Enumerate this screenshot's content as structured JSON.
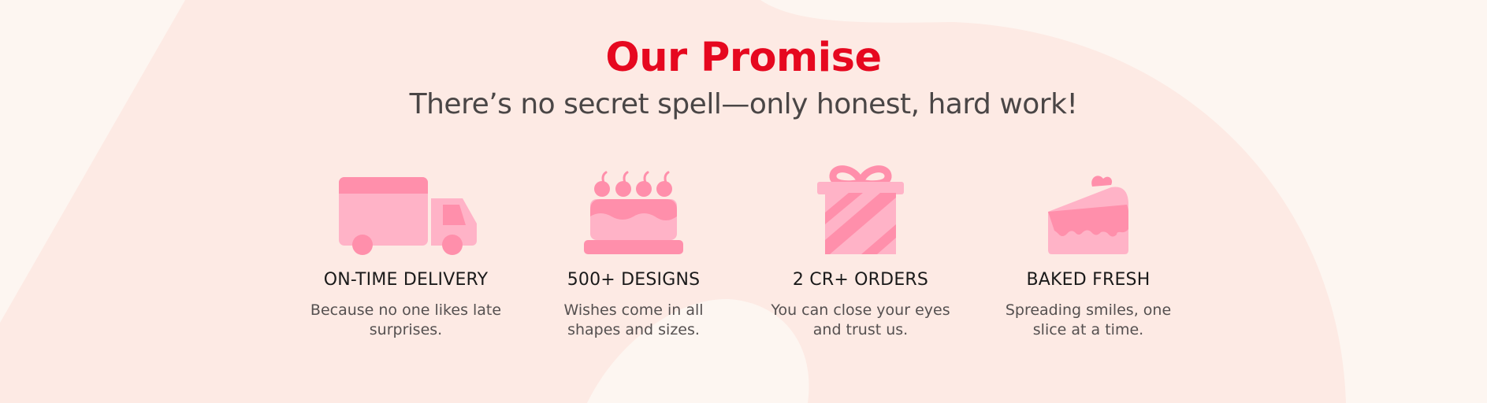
{
  "heading": {
    "title": "Our Promise",
    "subtitle": "There’s no secret spell—only honest, hard work!"
  },
  "features": [
    {
      "icon": "delivery-truck-icon",
      "title": "ON-TIME DELIVERY",
      "description": "Because no one likes late surprises."
    },
    {
      "icon": "cake-icon",
      "title": "500+ DESIGNS",
      "description": "Wishes come in all shapes and sizes."
    },
    {
      "icon": "gift-box-icon",
      "title": "2 CR+ ORDERS",
      "description": "You can close your eyes and trust us."
    },
    {
      "icon": "cake-slice-icon",
      "title": "BAKED FRESH",
      "description": "Spreading smiles, one slice at a time."
    }
  ],
  "colors": {
    "accent": "#e6081f",
    "icon_light": "#ffb3c7",
    "icon_dark": "#ff8fab",
    "background": "#fdf6f1",
    "background_shape": "#fdeae4"
  }
}
